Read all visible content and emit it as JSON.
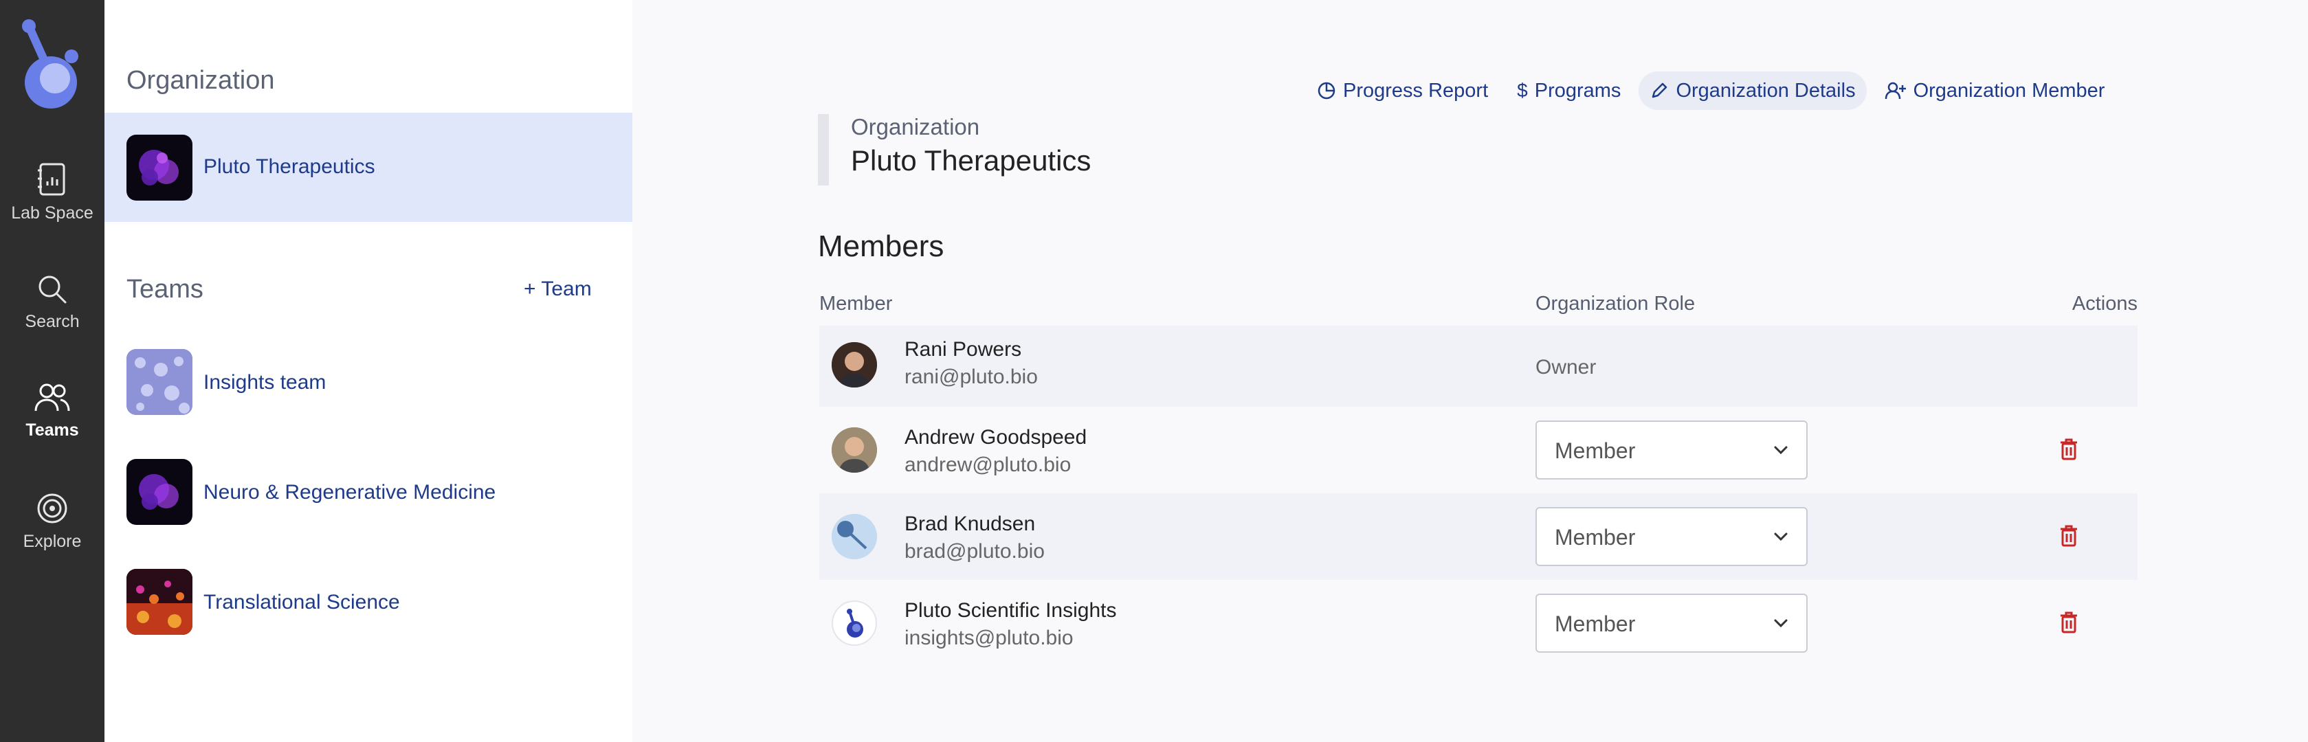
{
  "nav": {
    "items": [
      {
        "label": "Lab Space",
        "icon": "lab-space-icon"
      },
      {
        "label": "Search",
        "icon": "search-icon"
      },
      {
        "label": "Teams",
        "icon": "teams-icon"
      },
      {
        "label": "Explore",
        "icon": "explore-icon"
      }
    ],
    "active": "Teams"
  },
  "panel": {
    "organization_heading": "Organization",
    "organization_name": "Pluto Therapeutics",
    "teams_heading": "Teams",
    "add_team_label": "Team",
    "teams": [
      {
        "name": "Insights team"
      },
      {
        "name": "Neuro & Regenerative Medicine"
      },
      {
        "name": "Translational Science"
      }
    ]
  },
  "toolbar": {
    "progress_report": "Progress Report",
    "programs": "Programs",
    "organization_details": "Organization Details",
    "organization_member": "Organization Member"
  },
  "header": {
    "kicker": "Organization",
    "title": "Pluto Therapeutics"
  },
  "members": {
    "title": "Members",
    "columns": {
      "member": "Member",
      "role": "Organization Role",
      "actions": "Actions"
    },
    "rows": [
      {
        "name": "Rani Powers",
        "email": "rani@pluto.bio",
        "role": "Owner"
      },
      {
        "name": "Andrew Goodspeed",
        "email": "andrew@pluto.bio",
        "role": "Member"
      },
      {
        "name": "Brad Knudsen",
        "email": "brad@pluto.bio",
        "role": "Member"
      },
      {
        "name": "Pluto Scientific Insights",
        "email": "insights@pluto.bio",
        "role": "Member"
      }
    ]
  },
  "colors": {
    "accent": "#1e3a8a",
    "rail_bg": "#2e2e2e",
    "logo": "#6a7ee8",
    "danger": "#c62828",
    "selected_bg": "#e1e7fb"
  }
}
